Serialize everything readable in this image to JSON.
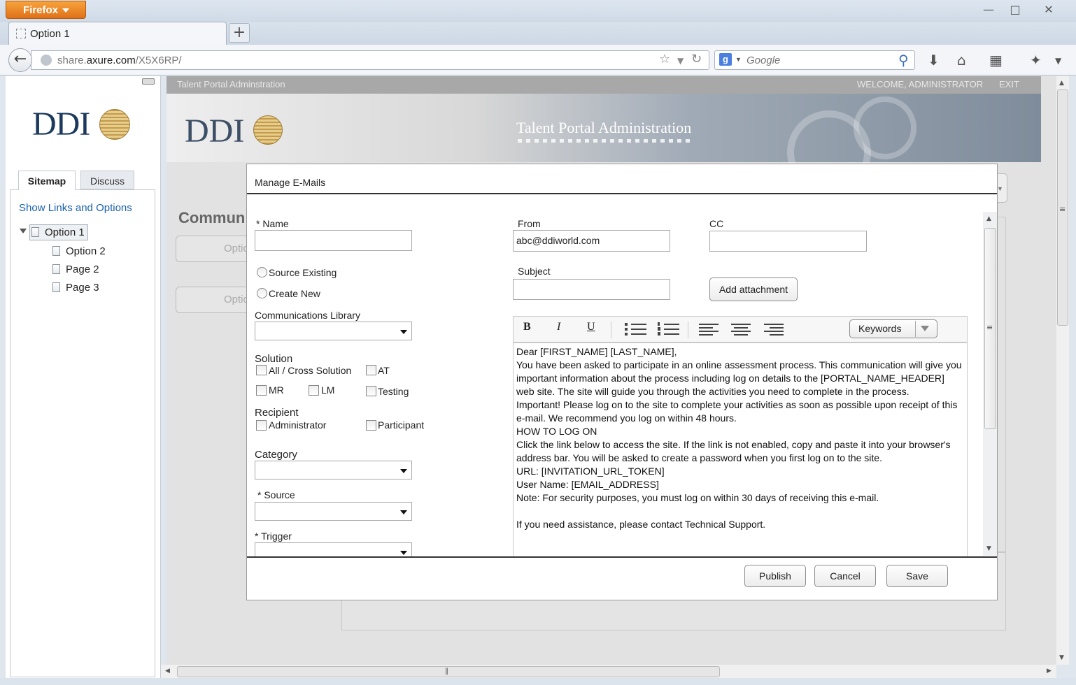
{
  "browser": {
    "app_button": "Firefox",
    "tab_title": "Option 1",
    "url_prefix": "share.",
    "url_domain": "axure.com",
    "url_path": "/X5X6RP/",
    "search_placeholder": "Google",
    "search_engine_letter": "g"
  },
  "sidebar": {
    "logo": "DDI",
    "tabs": [
      "Sitemap",
      "Discuss"
    ],
    "show_links": "Show Links and Options",
    "tree": [
      "Option 1",
      "Option 2",
      "Page 2",
      "Page 3"
    ]
  },
  "app": {
    "topbar_left": "Talent Portal Adminstration",
    "welcome": "WELCOME, ADMINISTRATOR",
    "exit": "EXIT",
    "banner_logo": "DDI",
    "banner_title": "Talent Portal Administration",
    "bg_heading": "Commun",
    "bg_button_1": "Optio",
    "bg_button_2": "Optio"
  },
  "modal": {
    "title": "Manage E-Mails",
    "name_label": "* Name",
    "name_value": "",
    "radio_source_existing": "Source Existing",
    "radio_create_new": "Create New",
    "comm_library_label": "Communications Library",
    "solution_label": "Solution",
    "solution_options": [
      "All / Cross Solution",
      "AT",
      "MR",
      "LM",
      "Testing"
    ],
    "recipient_label": "Recipient",
    "recipient_options": [
      "Administrator",
      "Participant"
    ],
    "category_label": "Category",
    "source_label": "* Source",
    "trigger_label": "* Trigger",
    "from_label": "From",
    "from_value": "abc@ddiworld.com",
    "cc_label": "CC",
    "cc_value": "",
    "subject_label": "Subject",
    "subject_value": "",
    "add_attachment": "Add attachment",
    "toolbar": {
      "bold": "B",
      "italic": "I",
      "underline": "U",
      "keywords": "Keywords"
    },
    "body_lines": [
      "Dear [FIRST_NAME] [LAST_NAME],",
      "You have been asked to participate in an online assessment process. This communication will give you important information about the process  including log on details to the [PORTAL_NAME_HEADER] web site. The site will guide you through the activities you need to complete in the process.",
      "Important! Please log on to the site to complete your activities as soon as possible upon receipt of this e-mail. We recommend you log on within 48  hours.",
      "HOW TO LOG ON",
      "Click the link below to access the site. If the link is not enabled, copy and paste it into your browser's address bar. You will be asked to create a  password when you first log on to the site.",
      "URL: [INVITATION_URL_TOKEN]",
      "User Name: [EMAIL_ADDRESS]",
      "Note: For security purposes, you must log on within 30 days of receiving this e-mail.",
      "",
      "If you need assistance, please contact Technical Support."
    ],
    "buttons": {
      "publish": "Publish",
      "cancel": "Cancel",
      "save": "Save"
    }
  }
}
